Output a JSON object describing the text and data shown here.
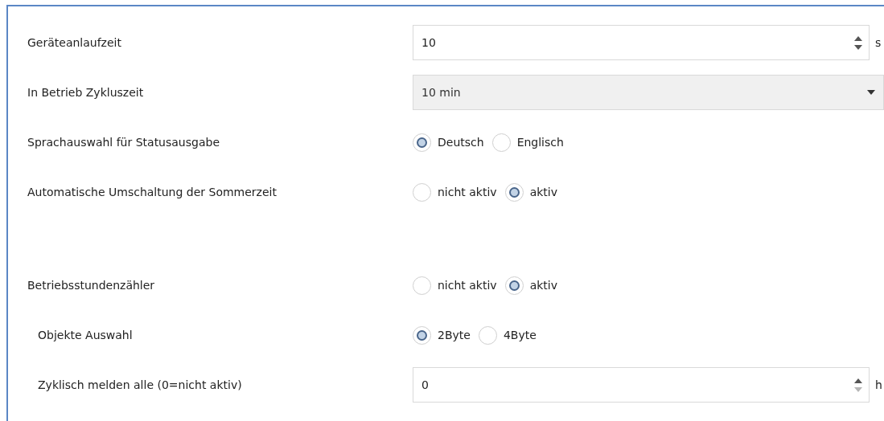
{
  "rows": [
    {
      "kind": "spin",
      "label": "Geräteanlaufzeit",
      "indented": false,
      "value": "10",
      "unit": "s",
      "down_disabled": false
    },
    {
      "kind": "select",
      "label": "In Betrieb Zykluszeit",
      "indented": false,
      "value": "10 min",
      "disabled": true
    },
    {
      "kind": "radio",
      "label": "Sprachauswahl für Statusausgabe",
      "indented": false,
      "options": [
        {
          "label": "Deutsch",
          "selected": true
        },
        {
          "label": "Englisch",
          "selected": false
        }
      ]
    },
    {
      "kind": "radio",
      "label": "Automatische Umschaltung der Sommerzeit",
      "indented": false,
      "options": [
        {
          "label": "nicht aktiv",
          "selected": false
        },
        {
          "label": "aktiv",
          "selected": true
        }
      ]
    },
    {
      "kind": "spacer"
    },
    {
      "kind": "radio",
      "label": "Betriebsstundenzähler",
      "indented": false,
      "options": [
        {
          "label": "nicht aktiv",
          "selected": false
        },
        {
          "label": "aktiv",
          "selected": true
        }
      ]
    },
    {
      "kind": "radio",
      "label": "Objekte Auswahl",
      "indented": true,
      "options": [
        {
          "label": "2Byte",
          "selected": true
        },
        {
          "label": "4Byte",
          "selected": false
        }
      ]
    },
    {
      "kind": "spin",
      "label": "Zyklisch melden alle (0=nicht aktiv)",
      "indented": true,
      "value": "0",
      "unit": "h",
      "down_disabled": true
    }
  ]
}
